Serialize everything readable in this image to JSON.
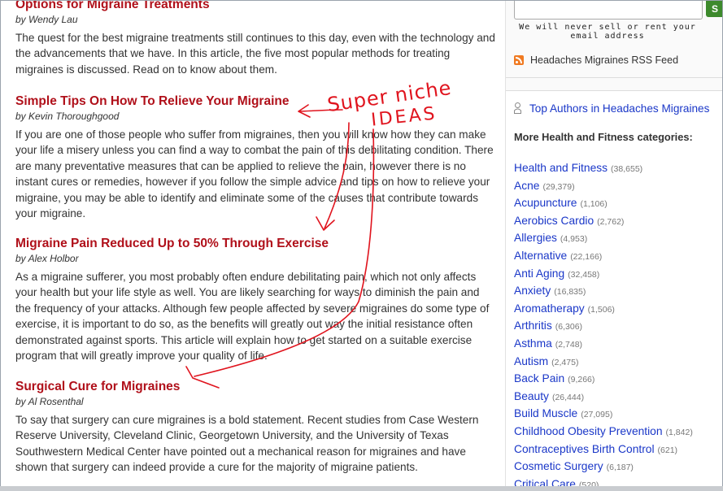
{
  "articles": [
    {
      "title": "Options for Migraine Treatments",
      "author": "by Wendy Lau",
      "body": "The quest for the best migraine treatments still continues to this day, even with the technology and the advancements that we have. In this article, the five most popular methods for treating migraines is discussed. Read on to know about them."
    },
    {
      "title": "Simple Tips On How To Relieve Your Migraine",
      "author": "by Kevin Thoroughgood",
      "body": "If you are one of those people who suffer from migraines, then you will know how they can make your life a misery unless you can find a way to combat the pain of this debilitating condition. There are many preventative measures that can be applied to relieve the pain, however there is no instant cures or remedies, however if you follow the simple advice and tips on how to relieve your migraine, you may be able to identify and eliminate some of the causes that contribute towards your migraine."
    },
    {
      "title": "Migraine Pain Reduced Up to 50% Through Exercise",
      "author": "by Alex Holbor",
      "body": "As a migraine sufferer, you most probably often endure debilitating pain, which not only affects your health but your life style as well. You are likely searching for ways to diminish the pain and the frequency of your attacks. Although few people affected by severe migraines do some type of exercise, it is important to do so, as the benefits will greatly out way the initial resistance often demonstrated against sports. This article will explain how to get started on a suitable exercise program that will greatly improve your quality of life."
    },
    {
      "title": "Surgical Cure for Migraines",
      "author": "by Al Rosenthal",
      "body": "To say that surgery can cure migraines is a bold statement.  Recent studies from Case Western Reserve University, Cleveland Clinic, Georgetown University, and the University of Texas Southwestern Medical Center have pointed out a mechanical reason for migraines and have shown that surgery can indeed provide a cure for the majority of migraine patients."
    }
  ],
  "sidebar": {
    "subscribe_label": "S",
    "email_note": "We will never sell or rent your email address",
    "rss_label": "Headaches Migraines RSS Feed",
    "top_authors": "Top Authors in Headaches Migraines",
    "more_categories": "More Health and Fitness categories:",
    "categories": [
      {
        "name": "Health and Fitness",
        "count": "(38,655)"
      },
      {
        "name": "Acne",
        "count": "(29,379)"
      },
      {
        "name": "Acupuncture",
        "count": "(1,106)"
      },
      {
        "name": "Aerobics Cardio",
        "count": "(2,762)"
      },
      {
        "name": "Allergies",
        "count": "(4,953)"
      },
      {
        "name": "Alternative",
        "count": "(22,166)"
      },
      {
        "name": "Anti Aging",
        "count": "(32,458)"
      },
      {
        "name": "Anxiety",
        "count": "(16,835)"
      },
      {
        "name": "Aromatherapy",
        "count": "(1,506)"
      },
      {
        "name": "Arthritis",
        "count": "(6,306)"
      },
      {
        "name": "Asthma",
        "count": "(2,748)"
      },
      {
        "name": "Autism",
        "count": "(2,475)"
      },
      {
        "name": "Back Pain",
        "count": "(9,266)"
      },
      {
        "name": "Beauty",
        "count": "(26,444)"
      },
      {
        "name": "Build Muscle",
        "count": "(27,095)"
      },
      {
        "name": "Childhood Obesity Prevention",
        "count": "(1,842)"
      },
      {
        "name": "Contraceptives Birth Control",
        "count": "(621)"
      },
      {
        "name": "Cosmetic Surgery",
        "count": "(6,187)"
      },
      {
        "name": "Critical Care",
        "count": "(520)"
      }
    ]
  },
  "annotation": {
    "line1": "Super niche",
    "line2": "IDEAS",
    "color": "#e0141e"
  }
}
